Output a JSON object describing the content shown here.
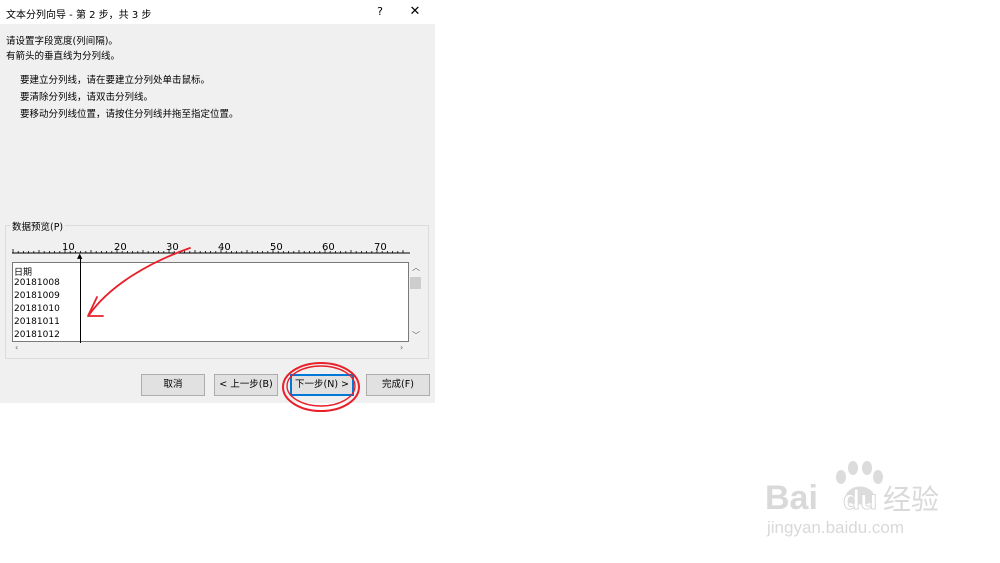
{
  "window": {
    "title": "文本分列向导 - 第 2 步，共 3 步",
    "help_label": "?",
    "close_label": "✕"
  },
  "instructions": {
    "line1": "请设置字段宽度(列间隔)。",
    "line2": "有箭头的垂直线为分列线。",
    "bullets": [
      "要建立分列线，请在要建立分列处单击鼠标。",
      "要清除分列线，请双击分列线。",
      "要移动分列线位置，请按住分列线并拖至指定位置。"
    ]
  },
  "preview": {
    "label": "数据预览(P)",
    "ruler_labels": [
      "10",
      "20",
      "30",
      "40",
      "50",
      "60",
      "70"
    ],
    "rows": [
      "日期",
      "20181008",
      "20181009",
      "20181010",
      "20181011",
      "20181012"
    ]
  },
  "buttons": {
    "cancel": "取消",
    "back": "< 上一步(B)",
    "next": "下一步(N) >",
    "finish": "完成(F)"
  },
  "watermark": {
    "brand": "Bai",
    "brand2": "du",
    "cn": "经验",
    "url": "jingyan.baidu.com"
  },
  "colors": {
    "annotation": "#e8202a",
    "accent": "#0078d7",
    "watermark": "#d9d9d9"
  }
}
